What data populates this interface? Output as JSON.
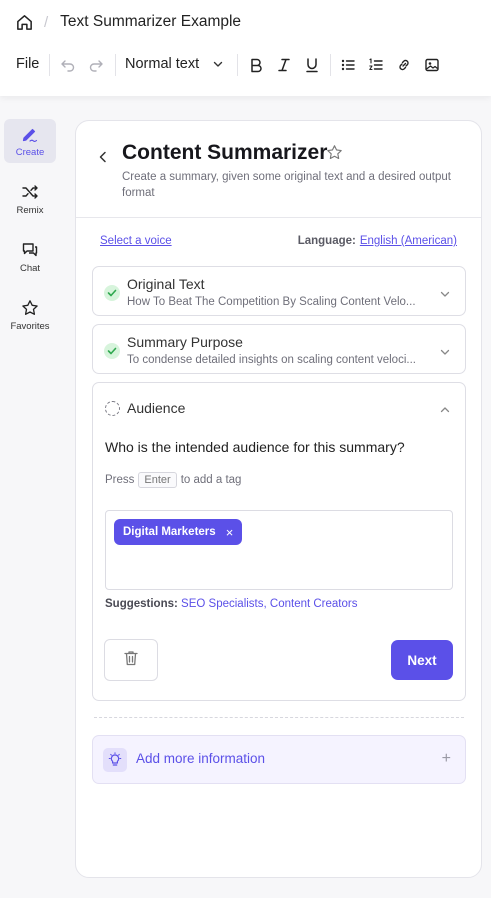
{
  "header": {
    "doc_title": "Text Summarizer Example",
    "breadcrumb_sep": "/"
  },
  "toolbar": {
    "file_label": "File",
    "text_style": "Normal text",
    "icons": [
      "undo-icon",
      "redo-icon",
      "bold-icon",
      "italic-icon",
      "underline-icon",
      "bullet-list-icon",
      "numbered-list-icon",
      "link-icon",
      "image-icon"
    ]
  },
  "sidebar": {
    "items": [
      {
        "label": "Create",
        "icon": "pen-icon",
        "active": true
      },
      {
        "label": "Remix",
        "icon": "shuffle-icon",
        "active": false
      },
      {
        "label": "Chat",
        "icon": "chat-icon",
        "active": false
      },
      {
        "label": "Favorites",
        "icon": "star-icon",
        "active": false
      }
    ]
  },
  "panel": {
    "title": "Content Summarizer",
    "description": "Create a summary, given some original text and a desired output format",
    "voice_link": "Select a voice",
    "language_label": "Language:",
    "language_value": "English (American)",
    "cards": [
      {
        "title": "Original Text",
        "subtitle": "How To Beat The Competition By Scaling Content Velo...",
        "status": "complete"
      },
      {
        "title": "Summary Purpose",
        "subtitle": "To condense detailed insights on scaling content veloci...",
        "status": "complete"
      }
    ],
    "audience": {
      "title": "Audience",
      "question": "Who is the intended audience for this summary?",
      "press_prefix": "Press",
      "press_key": "Enter",
      "press_suffix": "to add a tag",
      "tags": [
        "Digital Marketers"
      ],
      "tag_remove": "×",
      "suggestions_label": "Suggestions:",
      "suggestions": [
        "SEO Specialists,",
        "Content Creators"
      ],
      "next_label": "Next"
    },
    "add_info_label": "Add more information",
    "add_info_plus": "+"
  },
  "colors": {
    "accent": "#5b50e8",
    "check_bg": "#d7f4dc",
    "check_fg": "#2fa84f"
  }
}
